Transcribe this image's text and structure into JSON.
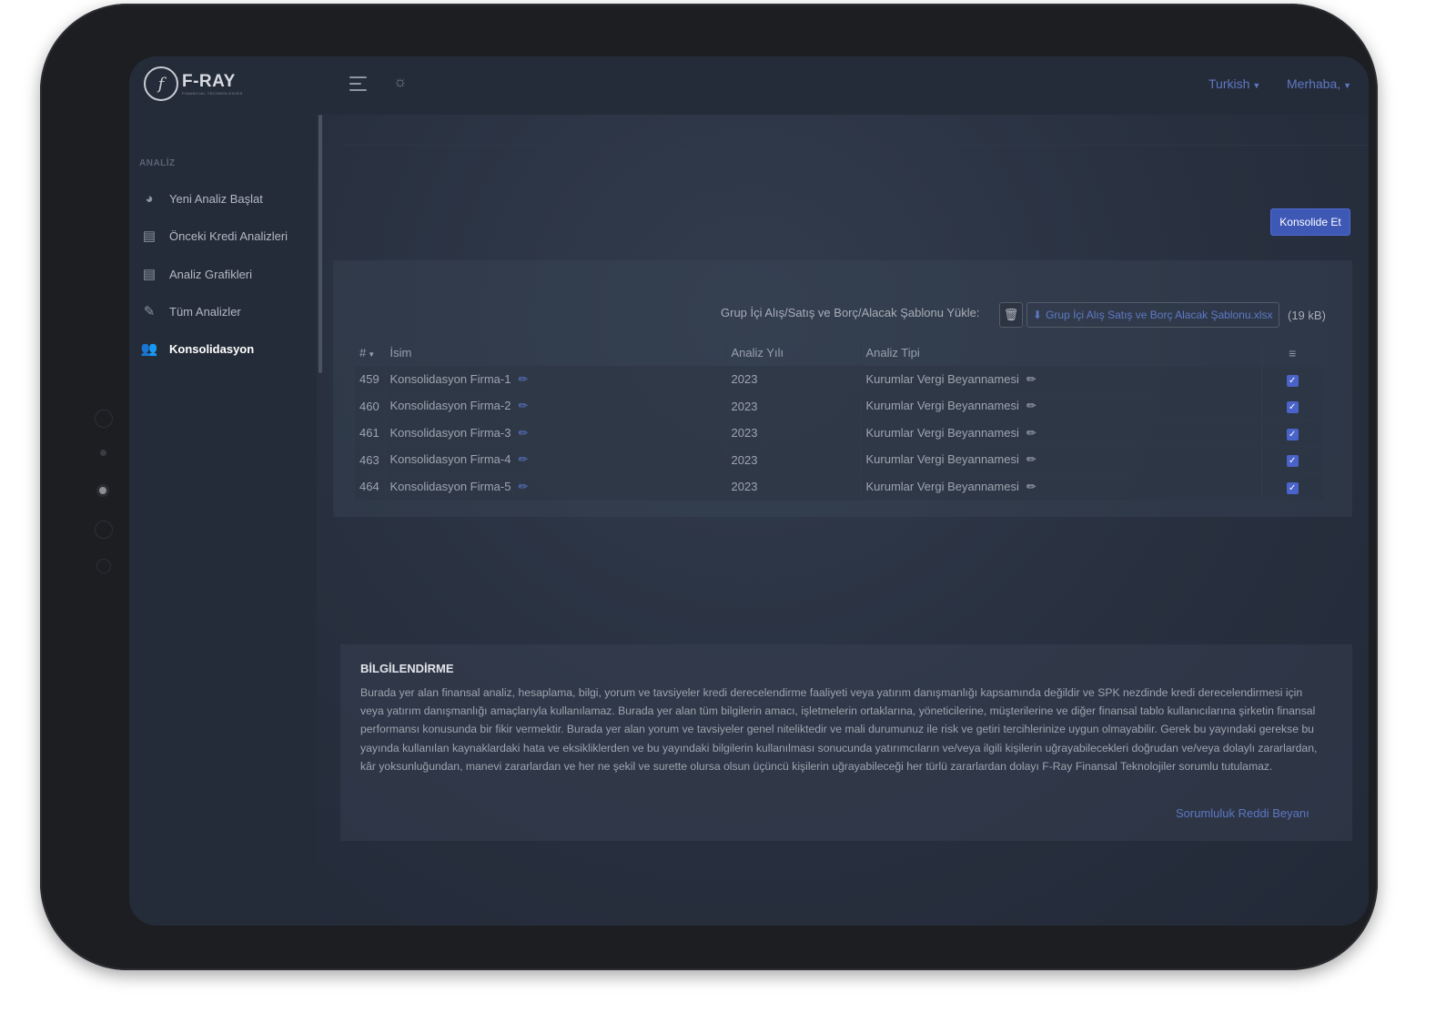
{
  "header": {
    "logo_glyph": "f",
    "logo_name": "F-RAY",
    "logo_sub": "FINANCIAL TECHNOLOGIES",
    "language": "Turkish",
    "user": "Merhaba,"
  },
  "sidebar": {
    "heading": "ANALİZ",
    "items": [
      {
        "label": "Yeni Analiz Başlat",
        "icon": "pie-chart-icon"
      },
      {
        "label": "Önceki Kredi Analizleri",
        "icon": "document-icon"
      },
      {
        "label": "Analiz Grafikleri",
        "icon": "document-icon"
      },
      {
        "label": "Tüm Analizler",
        "icon": "edit-document-icon"
      },
      {
        "label": "Konsolidasyon",
        "icon": "users-icon",
        "active": true
      }
    ]
  },
  "main": {
    "consolidate_button": "Konsolide Et",
    "upload_label": "Grup İçi Alış/Satış ve Borç/Alacak Şablonu Yükle:",
    "file_name": "Grup İçi Alış Satış ve Borç Alacak Şablonu.xlsx",
    "file_size": "(19 kB)",
    "table": {
      "headers": [
        "#",
        "İsim",
        "Analiz Yılı",
        "Analiz Tipi"
      ],
      "rows": [
        {
          "id": "459",
          "name": "Konsolidasyon Firma-1",
          "year": "2023",
          "type": "Kurumlar Vergi Beyannamesi"
        },
        {
          "id": "460",
          "name": "Konsolidasyon Firma-2",
          "year": "2023",
          "type": "Kurumlar Vergi Beyannamesi"
        },
        {
          "id": "461",
          "name": "Konsolidasyon Firma-3",
          "year": "2023",
          "type": "Kurumlar Vergi Beyannamesi"
        },
        {
          "id": "463",
          "name": "Konsolidasyon Firma-4",
          "year": "2023",
          "type": "Kurumlar Vergi Beyannamesi"
        },
        {
          "id": "464",
          "name": "Konsolidasyon Firma-5",
          "year": "2023",
          "type": "Kurumlar Vergi Beyannamesi"
        }
      ]
    }
  },
  "info": {
    "title": "BİLGİLENDİRME",
    "text": "Burada yer alan finansal analiz, hesaplama, bilgi, yorum ve tavsiyeler kredi derecelendirme faaliyeti veya yatırım danışmanlığı kapsamında değildir ve SPK nezdinde kredi derecelendirmesi için veya yatırım danışmanlığı amaçlarıyla kullanılamaz. Burada yer alan tüm bilgilerin amacı, işletmelerin ortaklarına, yöneticilerine, müşterilerine ve diğer finansal tablo kullanıcılarına şirketin finansal performansı konusunda bir fikir vermektir. Burada yer alan yorum ve tavsiyeler genel niteliktedir ve mali durumunuz ile risk ve getiri tercihlerinize uygun olmayabilir. Gerek bu yayındaki gerekse bu yayında kullanılan kaynaklardaki hata ve eksikliklerden ve bu yayındaki bilgilerin kullanılması sonucunda yatırımcıların ve/veya ilgili kişilerin uğrayabilecekleri doğrudan ve/veya dolaylı zararlardan, kâr yoksunluğundan, manevi zararlardan ve her ne şekil ve surette olursa olsun üçüncü kişilerin uğrayabileceği her türlü zararlardan dolayı F-Ray Finansal Teknolojiler sorumlu tutulamaz.",
    "link": "Sorumluluk Reddi Beyanı"
  },
  "colors": {
    "accent": "#3e58b6",
    "link": "#5e78c4",
    "background": "#28303f"
  }
}
